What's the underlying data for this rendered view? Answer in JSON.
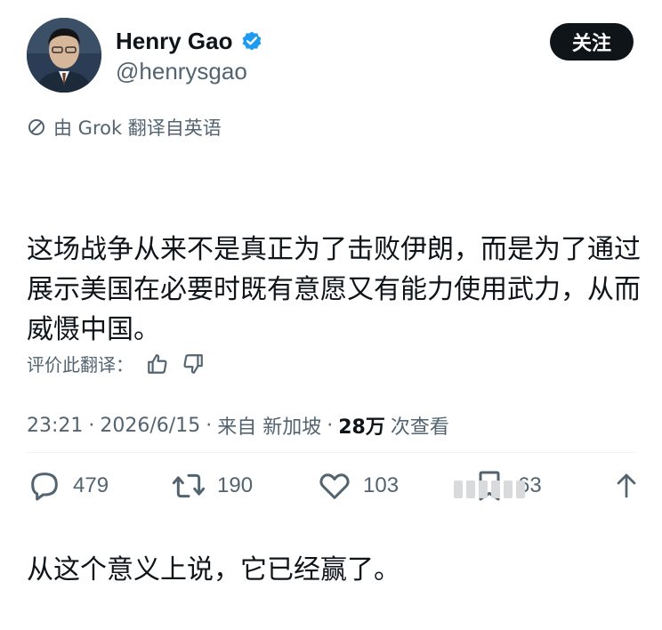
{
  "author": {
    "display_name": "Henry Gao",
    "handle": "@henrysgao",
    "verified": true,
    "avatar_icon": "profile-photo"
  },
  "follow_button": {
    "label": "关注"
  },
  "translation": {
    "label": "由 Grok 翻译自英语",
    "icon": "translate-icon"
  },
  "tweet": {
    "paragraph_1": "这场战争从来不是真正为了击败伊朗，而是为了通过展示美国在必要时既有意愿又有能力使用武力，从而威慑中国。",
    "paragraph_2": "从这个意义上说，它已经赢了。"
  },
  "rate_translation": {
    "label": "评价此翻译：",
    "thumbs_up_icon": "thumbs-up-icon",
    "thumbs_down_icon": "thumbs-down-icon"
  },
  "meta": {
    "time": "23:21",
    "date": "2026/6/15",
    "source": "来自 新加坡",
    "views_count": "28万",
    "views_label": "次查看",
    "separator": "·"
  },
  "actions": {
    "replies": "479",
    "retweets": "190",
    "likes": "103",
    "bookmarks": "63"
  },
  "colors": {
    "text_primary": "#0f1419",
    "text_secondary": "#536471",
    "verified_blue": "#1d9bf0",
    "button_bg": "#0f1419"
  }
}
